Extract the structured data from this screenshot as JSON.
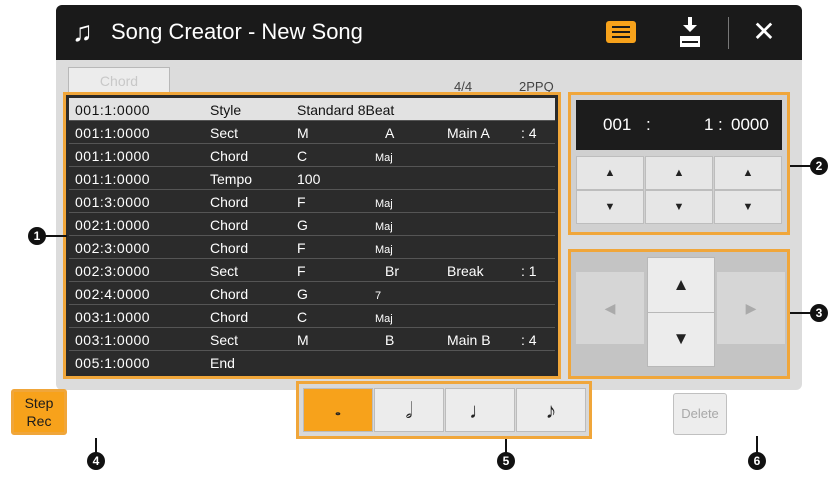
{
  "header": {
    "title": "Song Creator - New Song",
    "title_icon": "music-note-pen-icon",
    "close_glyph": "✕"
  },
  "tab": {
    "label": "Chord"
  },
  "info": {
    "time_signature": "4/4",
    "resolution": "2PPQ"
  },
  "events": [
    {
      "pos": "001:1:0000",
      "type": "Style",
      "d1": "Standard 8Beat",
      "d2": "",
      "sub": "",
      "d3": "",
      "d4": ""
    },
    {
      "pos": "001:1:0000",
      "type": "Sect",
      "d1": "M",
      "d2": "A",
      "sub": "",
      "d3": "Main A",
      "d4": ": 4"
    },
    {
      "pos": "001:1:0000",
      "type": "Chord",
      "d1": "C",
      "d2": "",
      "sub": "Maj",
      "d3": "",
      "d4": ""
    },
    {
      "pos": "001:1:0000",
      "type": "Tempo",
      "d1": "100",
      "d2": "",
      "sub": "",
      "d3": "",
      "d4": ""
    },
    {
      "pos": "001:3:0000",
      "type": "Chord",
      "d1": "F",
      "d2": "",
      "sub": "Maj",
      "d3": "",
      "d4": ""
    },
    {
      "pos": "002:1:0000",
      "type": "Chord",
      "d1": "G",
      "d2": "",
      "sub": "Maj",
      "d3": "",
      "d4": ""
    },
    {
      "pos": "002:3:0000",
      "type": "Chord",
      "d1": "F",
      "d2": "",
      "sub": "Maj",
      "d3": "",
      "d4": ""
    },
    {
      "pos": "002:3:0000",
      "type": "Sect",
      "d1": "F",
      "d2": "Br",
      "sub": "",
      "d3": "Break",
      "d4": ": 1"
    },
    {
      "pos": "002:4:0000",
      "type": "Chord",
      "d1": "G",
      "d2": "",
      "sub": "7",
      "d3": "",
      "d4": ""
    },
    {
      "pos": "003:1:0000",
      "type": "Chord",
      "d1": "C",
      "d2": "",
      "sub": "Maj",
      "d3": "",
      "d4": ""
    },
    {
      "pos": "003:1:0000",
      "type": "Sect",
      "d1": "M",
      "d2": "B",
      "sub": "",
      "d3": "Main B",
      "d4": ": 4"
    },
    {
      "pos": "005:1:0000",
      "type": "End",
      "d1": "",
      "d2": "",
      "sub": "",
      "d3": "",
      "d4": ""
    }
  ],
  "position": {
    "measure": "001",
    "sep1": ":",
    "beat": "1",
    "sep2": ":",
    "clock": "0000"
  },
  "arrows": {
    "up": "▲",
    "down": "▼",
    "left": "◀",
    "right": "▶"
  },
  "step_rec": {
    "line1": "Step",
    "line2": "Rec"
  },
  "note_lengths": [
    {
      "glyph": "𝅝",
      "icon": "whole-note-icon"
    },
    {
      "glyph": "𝅗𝅥",
      "icon": "half-note-icon"
    },
    {
      "glyph": "♩",
      "icon": "quarter-note-icon"
    },
    {
      "glyph": "♪",
      "icon": "eighth-note-icon"
    }
  ],
  "delete": {
    "label": "Delete"
  },
  "callouts": [
    "1",
    "2",
    "3",
    "4",
    "5",
    "6"
  ],
  "colors": {
    "accent": "#f7a21b",
    "frame": "#f0a63a",
    "title_bg": "#1a1a1a"
  }
}
